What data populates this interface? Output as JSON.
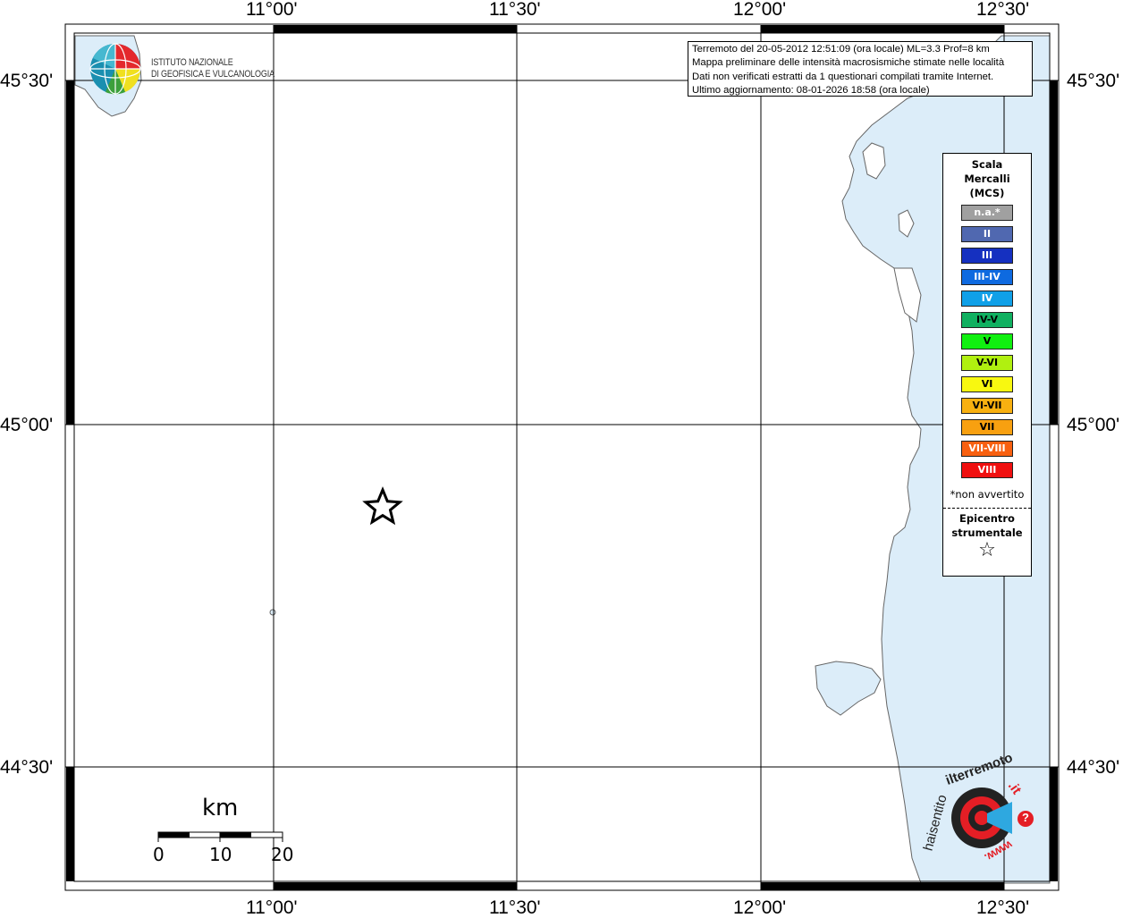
{
  "info_box": {
    "line1": "Terremoto del 20-05-2012 12:51:09 (ora locale) ML=3.3 Prof=8 km",
    "line2": "Mappa preliminare delle intensità macrosismiche stimate nelle località",
    "line3": "Dati non verificati estratti da 1 questionari compilati tramite Internet.",
    "line4": "Ultimo aggiornamento: 08-01-2026 18:58 (ora locale)"
  },
  "ingv_logo": {
    "line1": "ISTITUTO NAZIONALE",
    "line2": "DI GEOFISICA E VULCANOLOGIA"
  },
  "axis": {
    "top": [
      "11°00'",
      "11°30'",
      "12°00'",
      "12°30'"
    ],
    "bottom": [
      "11°00'",
      "11°30'",
      "12°00'",
      "12°30'"
    ],
    "left": [
      "45°30'",
      "45°00'",
      "44°30'"
    ],
    "right": [
      "45°30'",
      "45°00'",
      "44°30'"
    ]
  },
  "legend": {
    "title1": "Scala",
    "title2": "Mercalli",
    "title3": "(MCS)",
    "items": [
      {
        "label": "n.a.*",
        "color": "#a0a0a0"
      },
      {
        "label": "II",
        "color": "#5068b0"
      },
      {
        "label": "III",
        "color": "#1530c0"
      },
      {
        "label": "III-IV",
        "color": "#0e6ae0"
      },
      {
        "label": "IV",
        "color": "#10a0e8"
      },
      {
        "label": "IV-V",
        "color": "#10b060"
      },
      {
        "label": "V",
        "color": "#10f010"
      },
      {
        "label": "V-VI",
        "color": "#b0f010"
      },
      {
        "label": "VI",
        "color": "#f8f810"
      },
      {
        "label": "VI-VII",
        "color": "#f8b010"
      },
      {
        "label": "VII",
        "color": "#f8a010"
      },
      {
        "label": "VII-VIII",
        "color": "#f86010"
      },
      {
        "label": "VIII",
        "color": "#f01010"
      }
    ],
    "note": "*non avvertito",
    "epi1": "Epicentro",
    "epi2": "strumentale",
    "epi_symbol": "☆"
  },
  "scale_bar": {
    "unit": "km",
    "ticks": [
      "0",
      "10",
      "20"
    ]
  },
  "hsit_logo": {
    "text1": "haisentito",
    "text2": "ilterremoto",
    "text3": ".it",
    "text4": "www.",
    "qmark": "?"
  },
  "colors": {
    "sea": "#dcedf9",
    "land": "#ffffff",
    "coast": "#555555",
    "accent_red": "#e41e25"
  }
}
